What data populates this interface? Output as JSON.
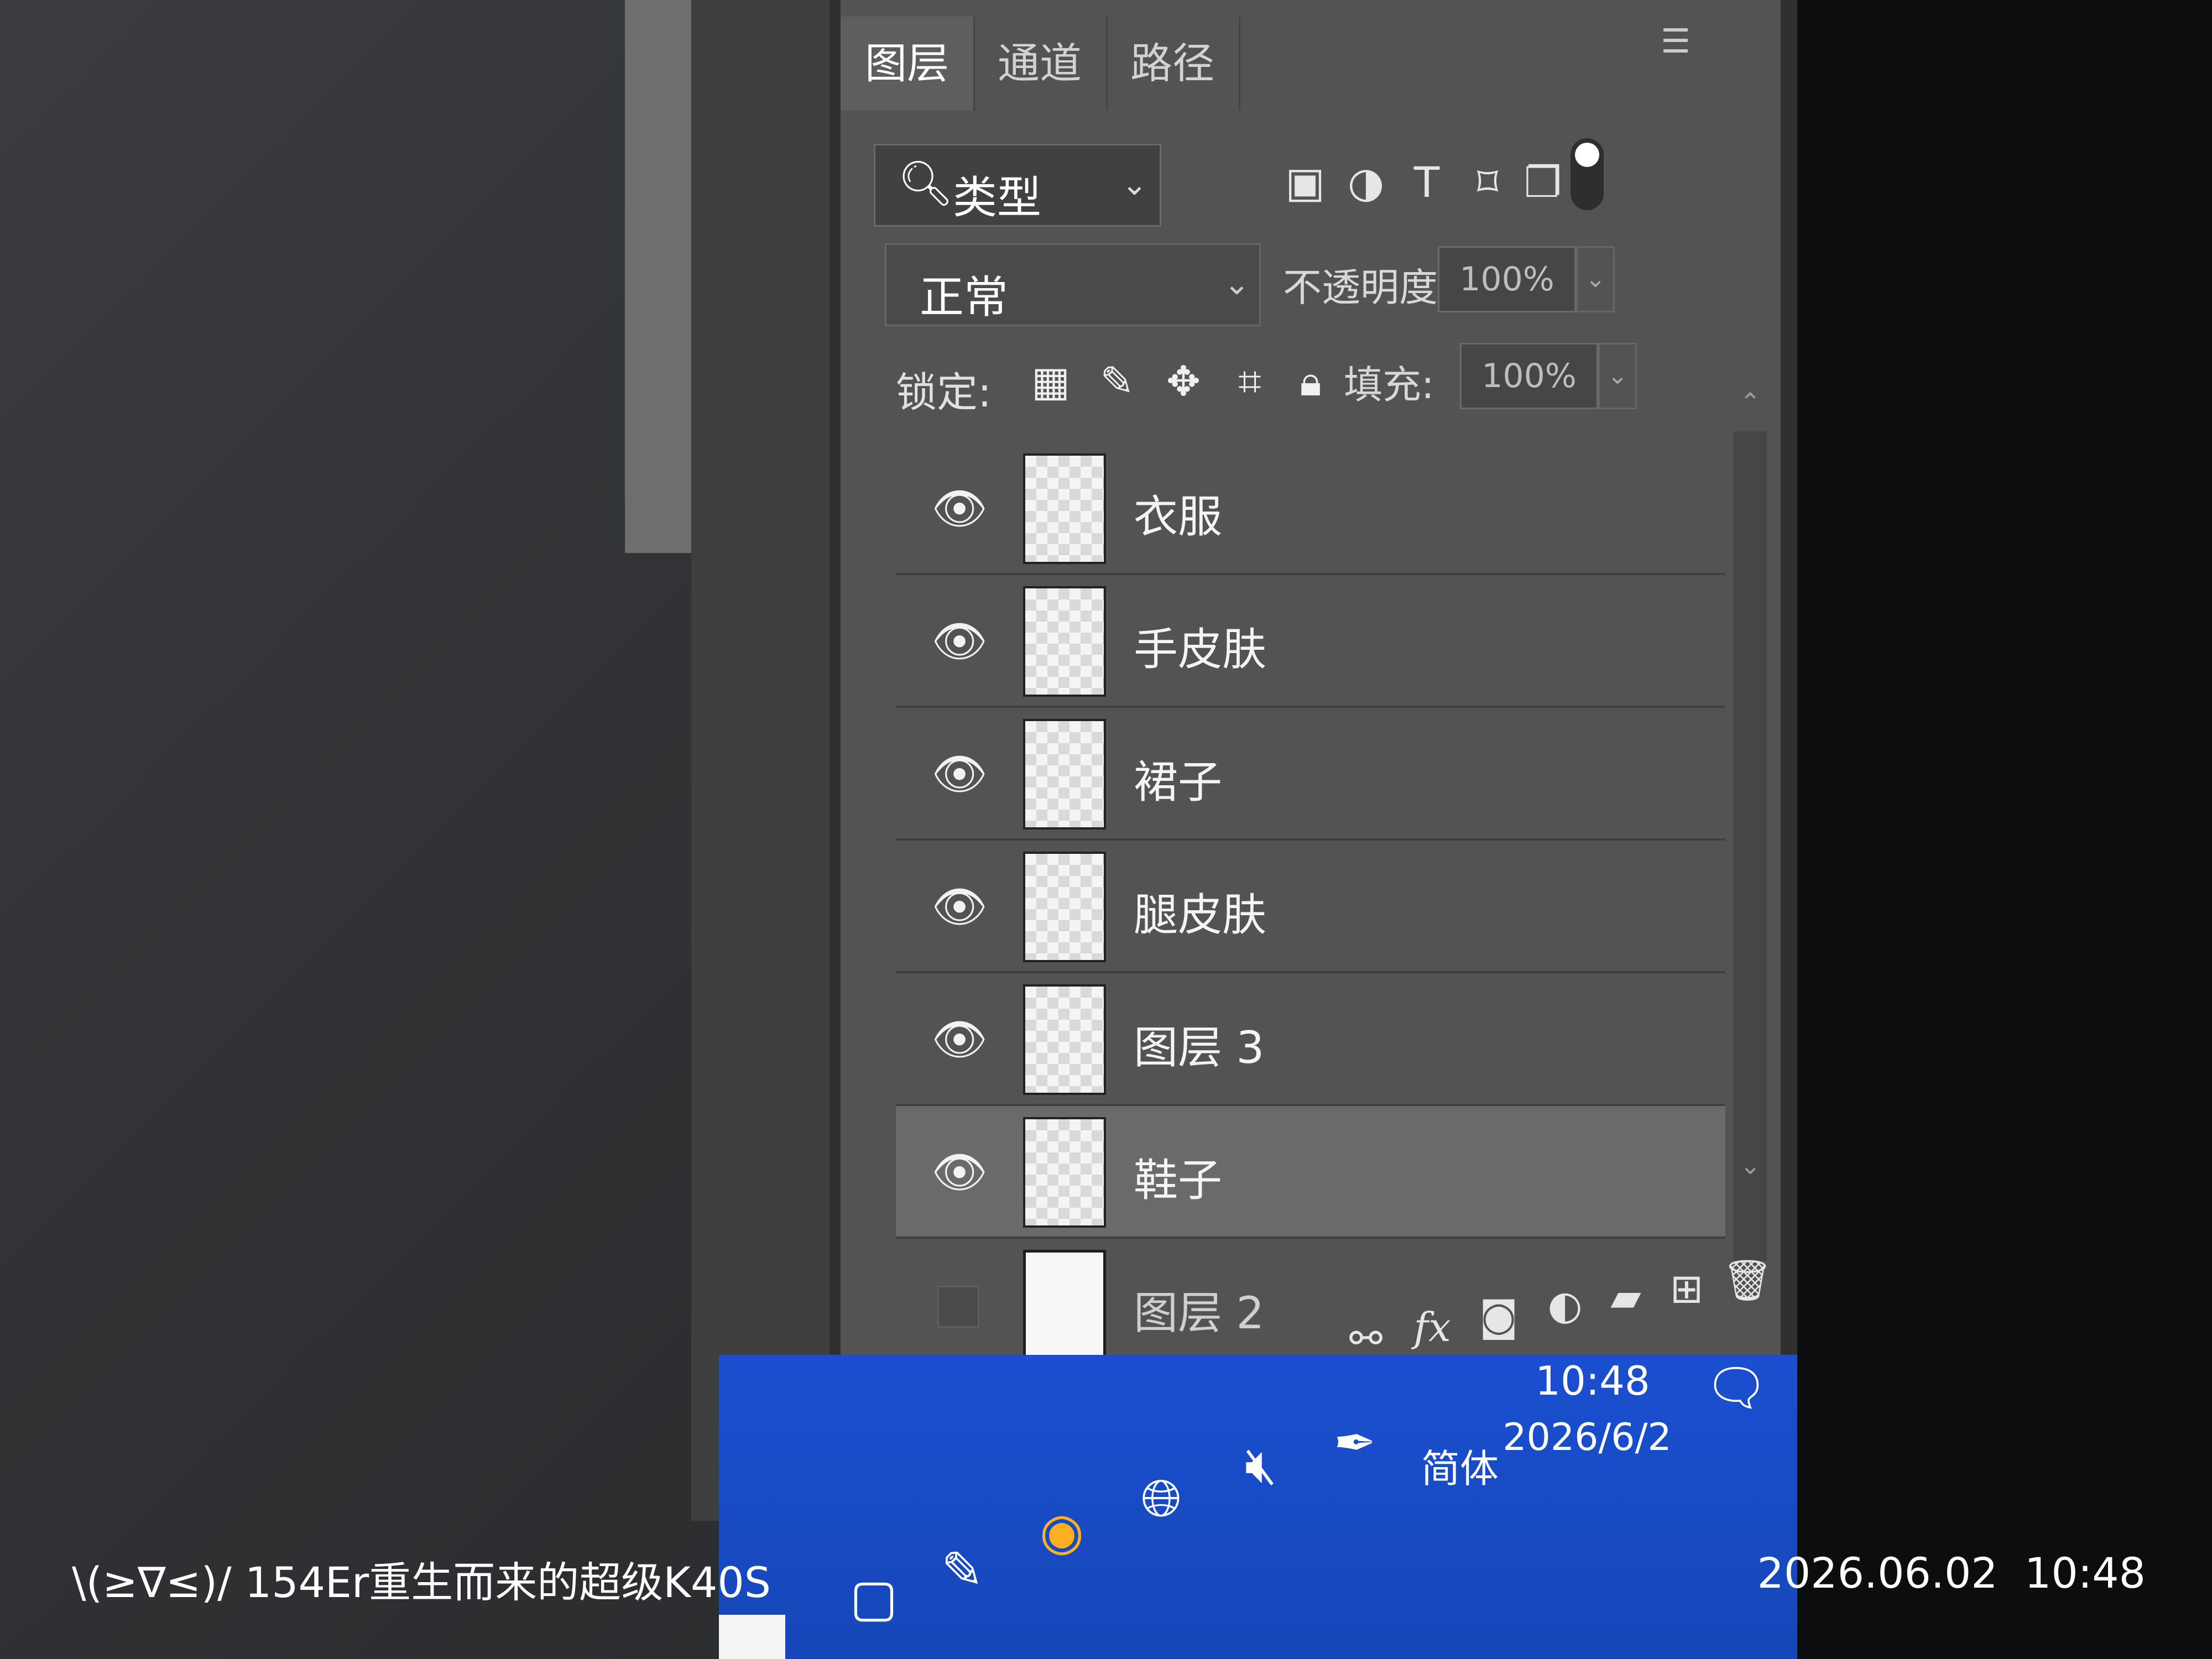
{
  "panel": {
    "tabs": [
      {
        "label": "图层"
      },
      {
        "label": "通道"
      },
      {
        "label": "路径"
      }
    ],
    "menu_icon": "hamburger-menu-icon",
    "filter": {
      "kind_label": "类型",
      "icons": [
        "image-filter-icon",
        "adjustment-filter-icon",
        "type-filter-icon",
        "shape-filter-icon",
        "smart-object-filter-icon"
      ]
    },
    "blend_mode": "正常",
    "opacity_label": "不透明度:",
    "opacity_value": "100%",
    "lock_label": "锁定:",
    "fill_label": "填充:",
    "fill_value": "100%",
    "layers": [
      {
        "name": "衣服",
        "visible": true
      },
      {
        "name": "手皮肤",
        "visible": true
      },
      {
        "name": "裙子",
        "visible": true
      },
      {
        "name": "腿皮肤",
        "visible": true
      },
      {
        "name": "图层 3",
        "visible": true
      },
      {
        "name": "鞋子",
        "visible": true,
        "selected": true
      },
      {
        "name": "图层 2",
        "visible": false
      }
    ],
    "bottom_icons": [
      "link-icon",
      "fx-icon",
      "mask-icon",
      "adjustment-icon",
      "folder-icon",
      "new-layer-icon",
      "trash-icon"
    ]
  },
  "taskbar": {
    "ime": "简体",
    "time": "10:48",
    "date": "2026/6/2"
  },
  "watermark": {
    "left": "\\(≥∇≤)/ 154Er重生而来的超级K40S",
    "right": "2026.06.02  10:48"
  },
  "colors": {
    "panel_bg": "#535353",
    "taskbar": "#1a4fd0",
    "selected_row": "#6a6a6a"
  }
}
